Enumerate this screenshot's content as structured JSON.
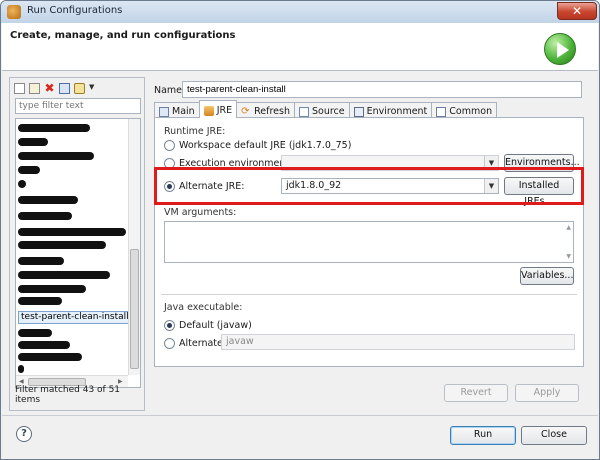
{
  "window": {
    "title": "Run Configurations",
    "close_glyph": "✕"
  },
  "banner": {
    "heading": "Create, manage, and run configurations",
    "icon": "run-icon"
  },
  "left": {
    "toolbar_icons": [
      "new-config-icon",
      "duplicate-icon",
      "delete-icon",
      "collapse-all-icon",
      "filter-icon",
      "chevron-down-icon"
    ],
    "delete_glyph": "✖",
    "chevron_glyph": "▼",
    "filter_placeholder": "type filter text",
    "selected_item": "test-parent-clean-install",
    "filter_status": "Filter matched 43 of 51 items"
  },
  "right": {
    "name_label": "Name:",
    "name_value": "test-parent-clean-install",
    "tabs": [
      {
        "label": "Main",
        "icon": "main-tab-icon",
        "active": false
      },
      {
        "label": "JRE",
        "icon": "jre-tab-icon",
        "active": true
      },
      {
        "label": "Refresh",
        "icon": "refresh-tab-icon",
        "active": false
      },
      {
        "label": "Source",
        "icon": "source-tab-icon",
        "active": false
      },
      {
        "label": "Environment",
        "icon": "environment-tab-icon",
        "active": false
      },
      {
        "label": "Common",
        "icon": "common-tab-icon",
        "active": false
      }
    ],
    "runtime_jre": {
      "group_title": "Runtime JRE:",
      "workspace_default": "Workspace default JRE (jdk1.7.0_75)",
      "execution_env_label": "Execution environment:",
      "execution_env_value": "",
      "environments_button": "Environments...",
      "alternate_label": "Alternate JRE:",
      "alternate_value": "jdk1.8.0_92",
      "installed_jres_button": "Installed JREs...",
      "selected": "alternate",
      "highlight_color": "#e01b1b"
    },
    "vm_args": {
      "label": "VM arguments:",
      "value": "",
      "variables_button": "Variables..."
    },
    "java_exec": {
      "group_title": "Java executable:",
      "default_label": "Default (javaw)",
      "alternate_label": "Alternate",
      "alternate_value": "javaw",
      "selected": "default"
    },
    "revert_button": "Revert",
    "apply_button": "Apply"
  },
  "footer": {
    "help_glyph": "?",
    "run_button": "Run",
    "close_button": "Close"
  }
}
